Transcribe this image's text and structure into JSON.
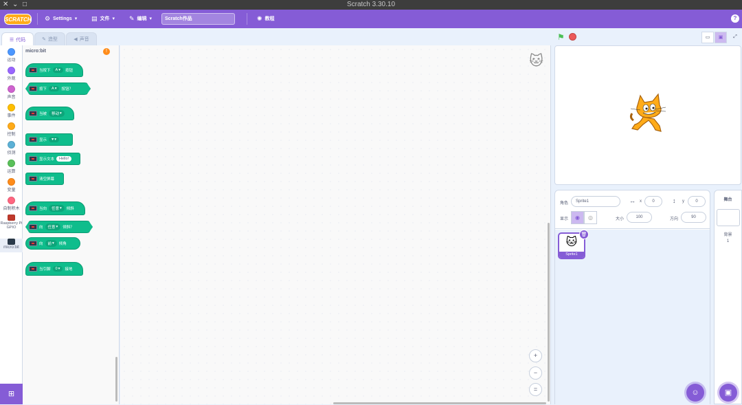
{
  "window": {
    "title": "Scratch 3.30.10",
    "controls": [
      "✕",
      "⌄",
      "□"
    ]
  },
  "menu": {
    "logo": "SCRATCH",
    "settings": "Settings",
    "file": "文件",
    "edit": "编辑",
    "project_title": "Scratch作品",
    "tutorials": "教程",
    "help": "?"
  },
  "tabs": [
    {
      "label": "代码",
      "icon": "code-icon",
      "active": true
    },
    {
      "label": "造型",
      "icon": "brush-icon",
      "active": false
    },
    {
      "label": "声音",
      "icon": "speaker-icon",
      "active": false
    }
  ],
  "categories": [
    {
      "label": "运动",
      "color": "#4c97ff"
    },
    {
      "label": "外观",
      "color": "#9966ff"
    },
    {
      "label": "声音",
      "color": "#cf63cf"
    },
    {
      "label": "事件",
      "color": "#ffbf00"
    },
    {
      "label": "控制",
      "color": "#ffab19"
    },
    {
      "label": "侦测",
      "color": "#5cb1d6"
    },
    {
      "label": "运算",
      "color": "#59c059"
    },
    {
      "label": "变量",
      "color": "#ff8c1a"
    },
    {
      "label": "自制积木",
      "color": "#ff6680"
    },
    {
      "label": "Raspberry Pi GPIO",
      "color": "#c0392b"
    },
    {
      "label": "micro:bit",
      "color": "#2b3a4a"
    }
  ],
  "palette": {
    "title": "micro:bit",
    "blocks": [
      {
        "text": "当按下",
        "opt": "A",
        "tail": "按钮"
      },
      {
        "text": "按下",
        "opt": "A",
        "tail": "按钮？"
      },
      {
        "text": "当被",
        "opt": "移动"
      },
      {
        "text": "显示",
        "opt": "♥"
      },
      {
        "text": "显示文本",
        "value": "Hello!"
      },
      {
        "text": "清空屏幕"
      },
      {
        "text": "当向",
        "opt": "任意",
        "tail": "倾斜"
      },
      {
        "text": "向",
        "opt": "任意",
        "tail": "倾斜？"
      },
      {
        "text": "向",
        "opt": "前",
        "tail": "倾角"
      },
      {
        "text": "当引脚",
        "opt": "0",
        "tail": "接地"
      }
    ]
  },
  "zoom": {
    "in": "+",
    "out": "−",
    "reset": "="
  },
  "sprite_info": {
    "sprite_label": "角色",
    "sprite_name": "Sprite1",
    "x_label": "x",
    "x": "0",
    "y_label": "y",
    "y": "0",
    "show_label": "显示",
    "size_label": "大小",
    "size": "100",
    "direction_label": "方向",
    "direction": "90"
  },
  "sprites": [
    {
      "name": "Sprite1"
    }
  ],
  "stage_pane": {
    "title": "舞台",
    "backdrops_label": "背景",
    "backdrops_count": "1"
  }
}
